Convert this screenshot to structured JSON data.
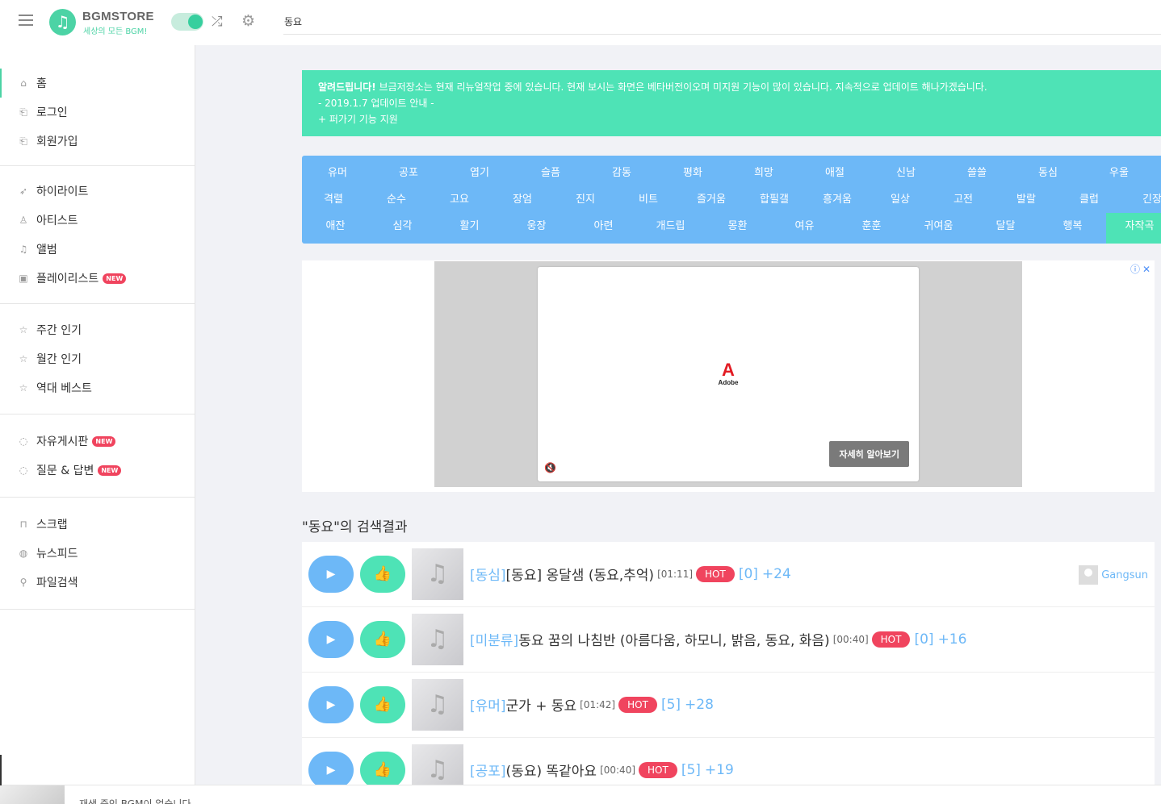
{
  "header": {
    "logo_icon": "music-note-icon",
    "logo_title": "BGMSTORE",
    "logo_subtitle": "세상의 모든 BGM!",
    "search_value": "동요",
    "accent": "#4cd3a5"
  },
  "sidebar": {
    "main": [
      {
        "label": "홈",
        "icon": "home-icon"
      },
      {
        "label": "로그인",
        "icon": "login-icon"
      },
      {
        "label": "회원가입",
        "icon": "signup-icon"
      }
    ],
    "browse": [
      {
        "label": "하이라이트",
        "icon": "rocket-icon"
      },
      {
        "label": "아티스트",
        "icon": "user-icon"
      },
      {
        "label": "앨범",
        "icon": "music-icon"
      },
      {
        "label": "플레이리스트",
        "icon": "playlist-icon",
        "badge": "NEW"
      }
    ],
    "charts": [
      {
        "label": "주간 인기",
        "icon": "star-icon"
      },
      {
        "label": "월간 인기",
        "icon": "star-icon"
      },
      {
        "label": "역대 베스트",
        "icon": "star-icon"
      }
    ],
    "community": [
      {
        "label": "자유게시판",
        "icon": "chat-icon",
        "badge": "NEW"
      },
      {
        "label": "질문 & 답변",
        "icon": "chat-icon",
        "badge": "NEW"
      }
    ],
    "tools": [
      {
        "label": "스크랩",
        "icon": "inbox-icon"
      },
      {
        "label": "뉴스피드",
        "icon": "globe-icon"
      },
      {
        "label": "파일검색",
        "icon": "search-icon"
      }
    ]
  },
  "notice": {
    "bold": "알려드립니다!",
    "line1": " 브금저장소는 현재 리뉴얼작업 중에 있습니다. 현재 보시는 화면은 베타버전이오며 미지원 기능이 많이 있습니다. 지속적으로 업데이트 해나가겠습니다.",
    "line2": "- 2019.1.7 업데이트 안내 -",
    "line3": "+ 퍼가기 기능 지원"
  },
  "categories": {
    "row1": [
      "유머",
      "공포",
      "엽기",
      "슬픔",
      "감동",
      "평화",
      "희망",
      "애절",
      "신남",
      "쓸쓸",
      "동심",
      "우울"
    ],
    "row2": [
      "격렬",
      "순수",
      "고요",
      "장엄",
      "진지",
      "비트",
      "즐거움",
      "합필갤",
      "흥겨움",
      "일상",
      "고전",
      "발랄",
      "클럽",
      "긴장"
    ],
    "row3": [
      "애잔",
      "심각",
      "활기",
      "웅장",
      "아련",
      "개드립",
      "몽환",
      "여유",
      "훈훈",
      "귀여움",
      "달달",
      "행복",
      "자작곡"
    ],
    "active": "자작곡",
    "blue": "#6db8f7",
    "green": "#4ee3b6"
  },
  "ad": {
    "brand": "Adobe",
    "cta": "자세히 알아보기",
    "info_icon": "info-close-icon"
  },
  "results": {
    "query_title": "\"동요\"의 검색결과",
    "items": [
      {
        "category": "[동심]",
        "title": "[동요] 옹달샘 (동요,추억)",
        "duration": "[01:11]",
        "hot": "HOT",
        "comments": "[0]",
        "likes": "+24",
        "uploader": "Gangsun"
      },
      {
        "category": "[미분류]",
        "title": "동요 꿈의 나침반 (아름다움, 하모니, 밝음, 동요, 화음)",
        "duration": "[00:40]",
        "hot": "HOT",
        "comments": "[0]",
        "likes": "+16",
        "uploader": ""
      },
      {
        "category": "[유머]",
        "title": "군가 + 동요",
        "duration": "[01:42]",
        "hot": "HOT",
        "comments": "[5]",
        "likes": "+28",
        "uploader": ""
      },
      {
        "category": "[공포]",
        "title": "(동요) 똑같아요",
        "duration": "[00:40]",
        "hot": "HOT",
        "comments": "[5]",
        "likes": "+19",
        "uploader": ""
      }
    ]
  },
  "player": {
    "status": "재생 중인 BGM이 없습니다"
  }
}
